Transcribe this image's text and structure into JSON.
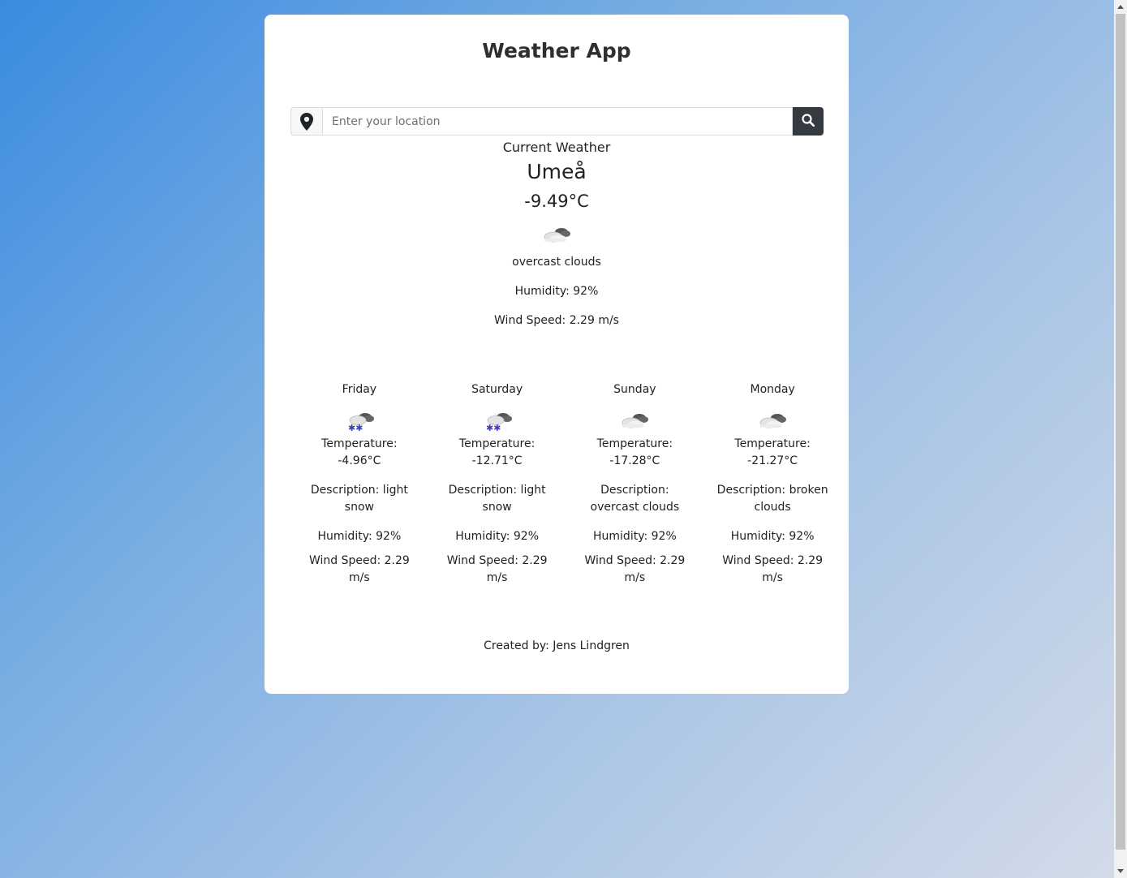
{
  "app": {
    "title": "Weather App"
  },
  "search": {
    "placeholder": "Enter your location",
    "value": ""
  },
  "current": {
    "heading": "Current Weather",
    "city": "Umeå",
    "temperature": "-9.49°C",
    "icon": "overcast-clouds-icon",
    "description": "overcast clouds",
    "humidity": "Humidity: 92%",
    "wind": "Wind Speed: 2.29 m/s"
  },
  "forecast": [
    {
      "day": "Friday",
      "icon": "light-snow-icon",
      "temperature_label": "Temperature:",
      "temperature": "-4.96°C",
      "description": "Description: light snow",
      "humidity": "Humidity: 92%",
      "wind": "Wind Speed: 2.29 m/s"
    },
    {
      "day": "Saturday",
      "icon": "light-snow-icon",
      "temperature_label": "Temperature:",
      "temperature": "-12.71°C",
      "description": "Description: light snow",
      "humidity": "Humidity: 92%",
      "wind": "Wind Speed: 2.29 m/s"
    },
    {
      "day": "Sunday",
      "icon": "overcast-clouds-icon",
      "temperature_label": "Temperature:",
      "temperature": "-17.28°C",
      "description": "Description: overcast clouds",
      "humidity": "Humidity: 92%",
      "wind": "Wind Speed: 2.29 m/s"
    },
    {
      "day": "Monday",
      "icon": "broken-clouds-icon",
      "temperature_label": "Temperature:",
      "temperature": "-21.27°C",
      "description": "Description: broken clouds",
      "humidity": "Humidity: 92%",
      "wind": "Wind Speed: 2.29 m/s"
    }
  ],
  "footer": {
    "credit": "Created by: Jens Lindgren"
  },
  "colors": {
    "button_bg": "#343a40",
    "card_bg": "#ffffff",
    "gradient_start": "#3a8be0",
    "gradient_end": "#d3dbe8"
  }
}
